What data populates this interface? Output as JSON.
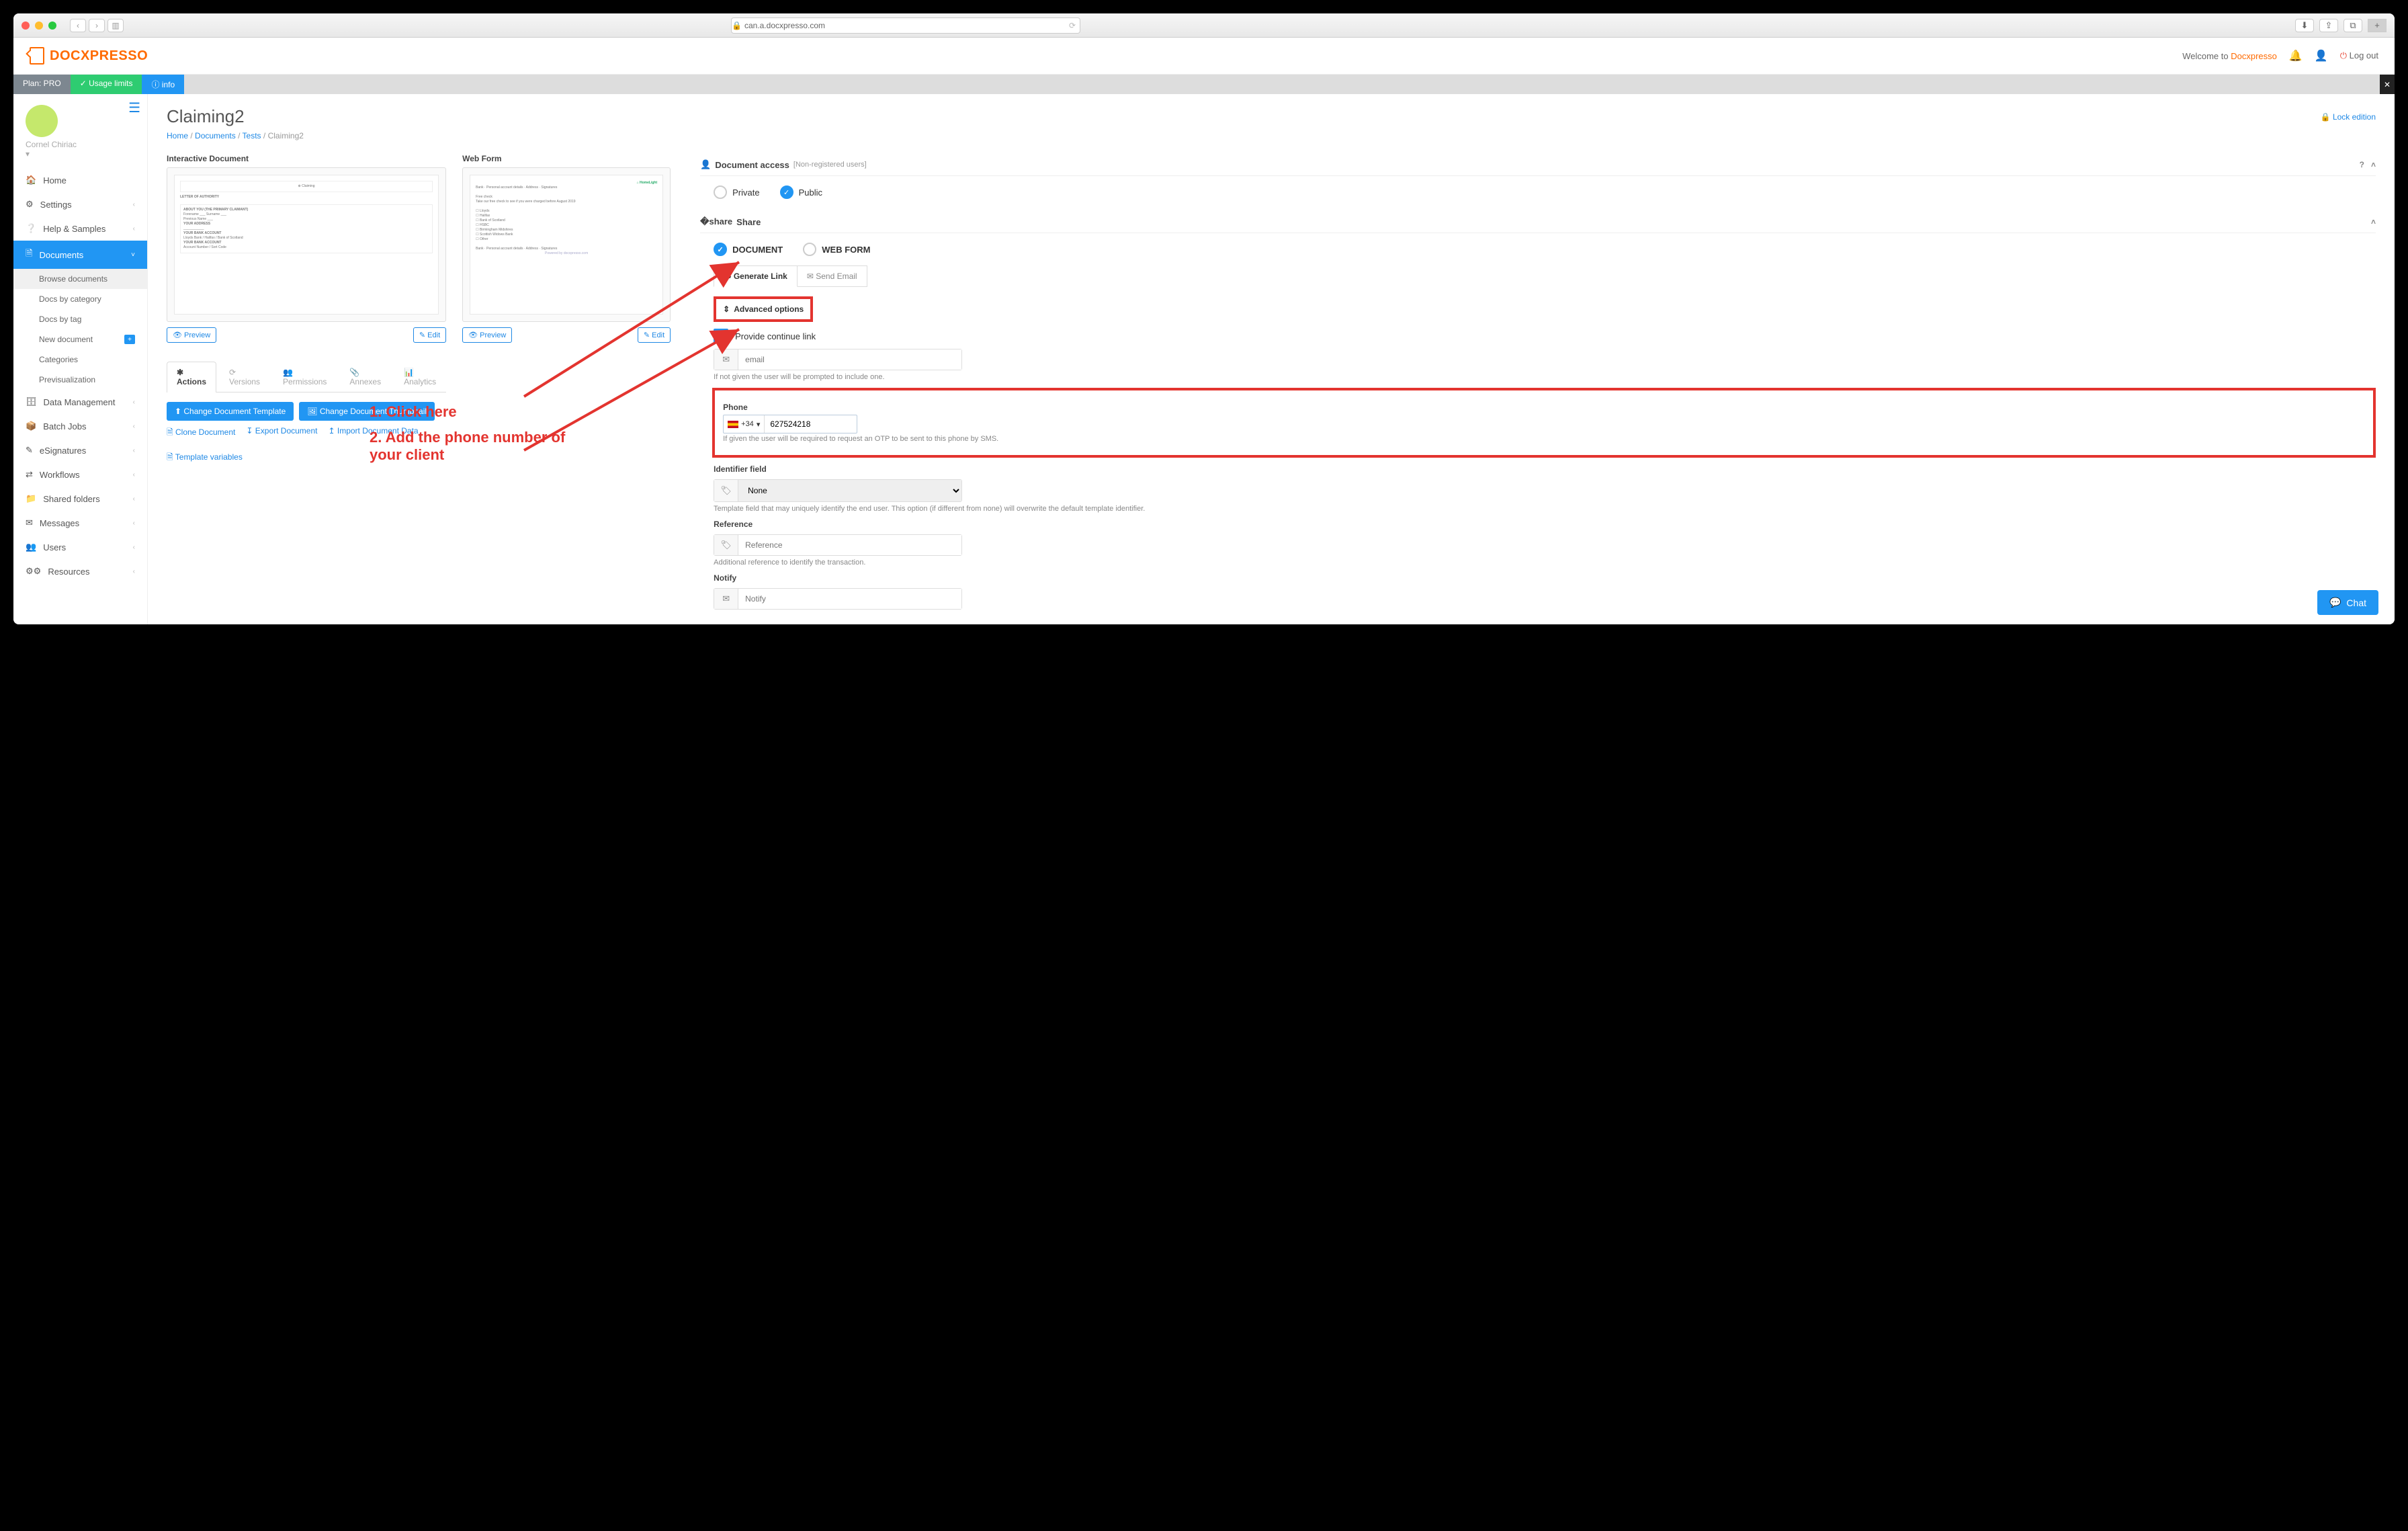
{
  "browser": {
    "url": "can.a.docxpresso.com"
  },
  "header": {
    "brand": "DOCXPRESSO",
    "welcome_prefix": "Welcome to ",
    "welcome_brand": "Docxpresso",
    "logout": "Log out"
  },
  "topbar": {
    "plan": "Plan: PRO",
    "usage": "Usage limits",
    "info": "info"
  },
  "user": {
    "name": "Cornel Chiriac"
  },
  "sidebar": {
    "items": [
      {
        "label": "Home",
        "icon": "home"
      },
      {
        "label": "Settings",
        "icon": "gear"
      },
      {
        "label": "Help & Samples",
        "icon": "help"
      },
      {
        "label": "Documents",
        "icon": "copy",
        "active": true
      },
      {
        "label": "Data Management",
        "icon": "layers"
      },
      {
        "label": "Batch Jobs",
        "icon": "box"
      },
      {
        "label": "eSignatures",
        "icon": "pen"
      },
      {
        "label": "Workflows",
        "icon": "flow"
      },
      {
        "label": "Shared folders",
        "icon": "folder"
      },
      {
        "label": "Messages",
        "icon": "envelope"
      },
      {
        "label": "Users",
        "icon": "users"
      },
      {
        "label": "Resources",
        "icon": "gears"
      }
    ],
    "sub_docs": {
      "browse": "Browse documents",
      "by_category": "Docs by category",
      "by_tag": "Docs by tag",
      "new": "New document",
      "categories": "Categories",
      "previsualization": "Previsualization"
    }
  },
  "page": {
    "title": "Claiming2",
    "lock_edition": "Lock edition",
    "breadcrumb": {
      "home": "Home",
      "documents": "Documents",
      "tests": "Tests",
      "current": "Claiming2"
    }
  },
  "preview": {
    "interactive_doc": "Interactive Document",
    "web_form": "Web Form",
    "preview_btn": "Preview",
    "edit_btn": "Edit"
  },
  "access": {
    "title": "Document access",
    "sub": "[Non-registered users]",
    "private": "Private",
    "public": "Public"
  },
  "share": {
    "title": "Share",
    "document": "DOCUMENT",
    "webform": "WEB FORM",
    "generate_link": "Generate Link",
    "send_email": "Send Email",
    "advanced": "Advanced options",
    "provide_continue": "Provide continue link",
    "email_placeholder": "email",
    "email_hint": "If not given the user will be prompted to include one.",
    "phone_label": "Phone",
    "phone_prefix": "+34",
    "phone_value": "627524218",
    "phone_hint": "If given the user will be required to request an OTP to be sent to this phone by SMS.",
    "identifier_label": "Identifier field",
    "identifier_value": "None",
    "identifier_hint": "Template field that may uniquely identify the end user. This option (if different from none) will overwrite the default template identifier.",
    "reference_label": "Reference",
    "reference_placeholder": "Reference",
    "reference_hint": "Additional reference to identify the transaction.",
    "notify_label": "Notify",
    "notify_placeholder": "Notify"
  },
  "tabs": {
    "actions": "Actions",
    "versions": "Versions",
    "permissions": "Permissions",
    "annexes": "Annexes",
    "analytics": "Analytics"
  },
  "actions": {
    "change_template": "Change Document Template",
    "change_thumbnail": "Change Document Thumbnail",
    "clone": "Clone Document",
    "export": "Export Document",
    "import": "Import Document Data",
    "template_vars": "Template variables"
  },
  "annotations": {
    "step1": "1. Click here",
    "step2": "2. Add the phone number of your client"
  },
  "chat": "Chat"
}
